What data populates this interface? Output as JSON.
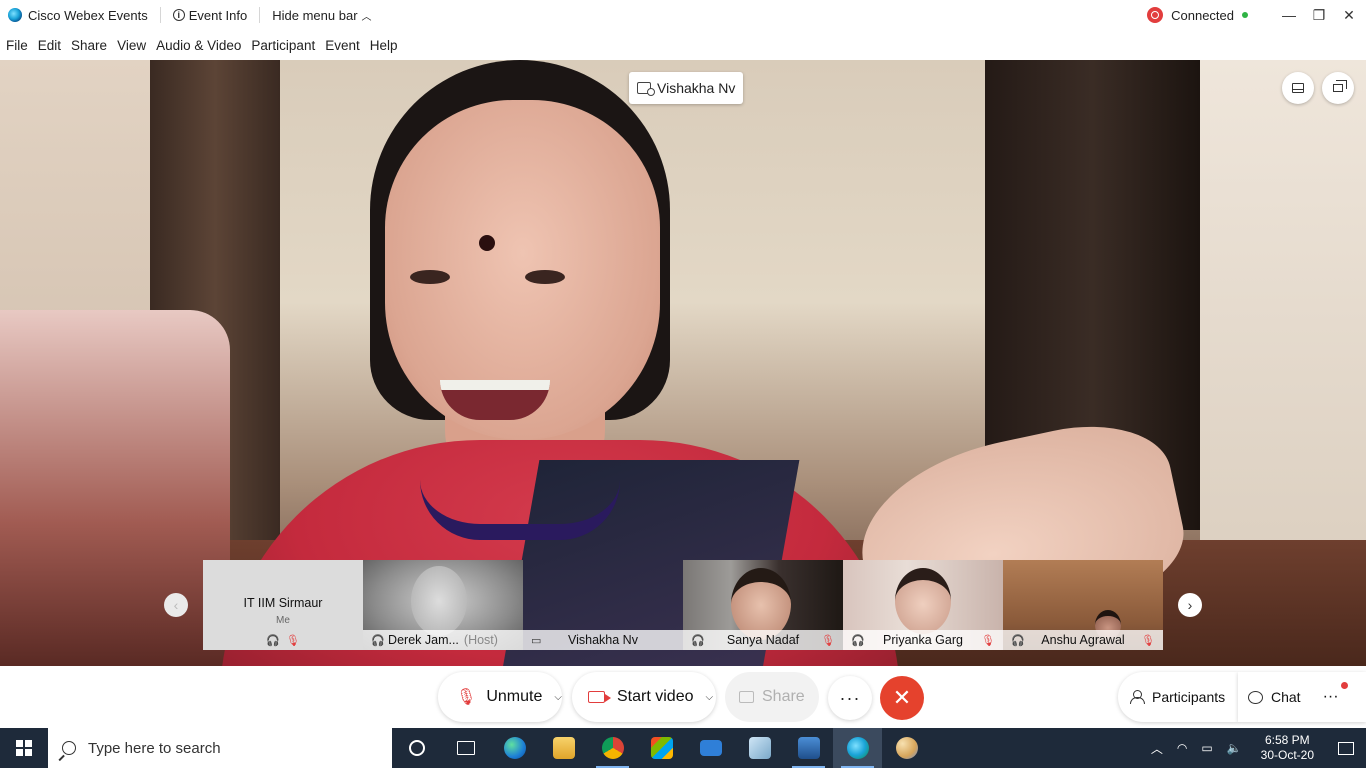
{
  "titlebar": {
    "app_title": "Cisco Webex Events",
    "event_info": "Event Info",
    "hide_menu": "Hide menu bar",
    "status": "Connected",
    "minimize": "—",
    "maximize": "❐",
    "close": "✕"
  },
  "menu": [
    "File",
    "Edit",
    "Share",
    "View",
    "Audio & Video",
    "Participant",
    "Event",
    "Help"
  ],
  "stage": {
    "active_speaker": "Vishakha Nv"
  },
  "filmstrip": {
    "me": {
      "name": "IT IIM Sirmaur",
      "sub": "Me"
    },
    "tiles": [
      {
        "name": "Derek Jam...",
        "note": "(Host)"
      },
      {
        "name": "Vishakha Nv"
      },
      {
        "name": "Sanya Nadaf"
      },
      {
        "name": "Priyanka Garg"
      },
      {
        "name": "Anshu Agrawal"
      }
    ]
  },
  "controls": {
    "unmute": "Unmute",
    "start_video": "Start video",
    "share": "Share",
    "more": "···",
    "end": "✕",
    "participants": "Participants",
    "chat": "Chat",
    "overflow": "···"
  },
  "taskbar": {
    "search_placeholder": "Type here to search",
    "time": "6:58 PM",
    "date": "30-Oct-20"
  },
  "colors": {
    "accent_red": "#e23d3d",
    "end_call": "#e5422d",
    "connected_green": "#2fb344",
    "taskbar_bg": "#1e2a3a"
  }
}
